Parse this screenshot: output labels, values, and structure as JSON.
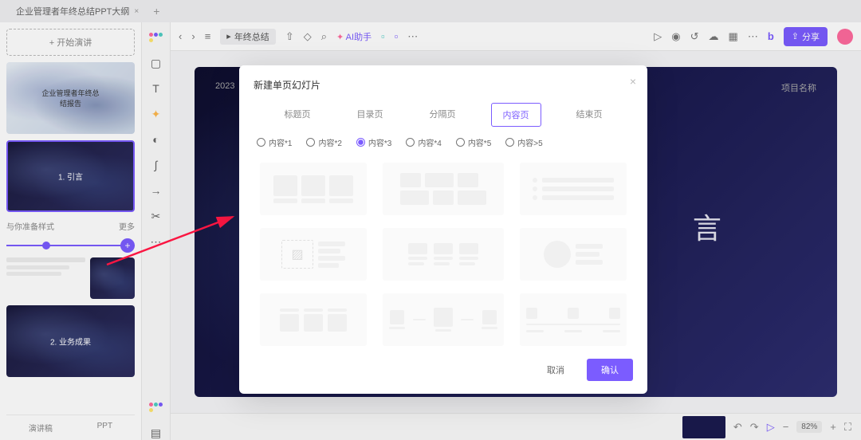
{
  "fileTab": "企业管理者年终总结PPT大纲",
  "leftPanel": {
    "addSlide": "+ 开始演讲",
    "slides": [
      {
        "title": "企业管理者年终总结报告"
      },
      {
        "title": "1. 引言"
      },
      {
        "title": "2. 业务成果"
      }
    ],
    "sectionLabel": "与你准备样式",
    "sectionMore": "更多",
    "footer1": "演讲稿",
    "footer2": "PPT"
  },
  "toolbar": {
    "docTitle": "年终总结",
    "aiAssistant": "AI助手",
    "share": "分享"
  },
  "canvas": {
    "year": "2023",
    "project": "项目名称",
    "heading": "言"
  },
  "bottomBar": {
    "zoom": "82%"
  },
  "modal": {
    "title": "新建单页幻灯片",
    "tabs": [
      "标题页",
      "目录页",
      "分隔页",
      "内容页",
      "结束页"
    ],
    "activeTab": 3,
    "radios": [
      "内容*1",
      "内容*2",
      "内容*3",
      "内容*4",
      "内容*5",
      "内容>5"
    ],
    "activeRadio": 2,
    "cancel": "取消",
    "confirm": "确认"
  }
}
